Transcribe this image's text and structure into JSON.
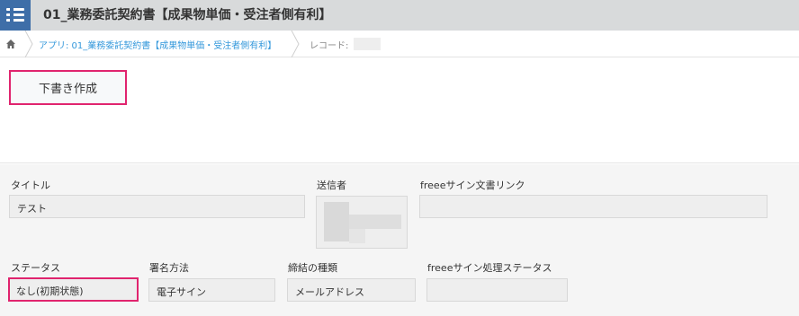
{
  "header": {
    "title": "01_業務委託契約書【成果物単価・受注者側有利】",
    "icon": "menu-list-icon"
  },
  "breadcrumb": {
    "home_icon": "home-icon",
    "app_link": "アプリ: 01_業務委託契約書【成果物単価・受注者側有利】",
    "record_label": "レコード:"
  },
  "toolbar": {
    "draft_button": "下書き作成"
  },
  "form": {
    "title_label": "タイトル",
    "title_value": "テスト",
    "sender_label": "送信者",
    "doc_link_label": "freeeサイン文書リンク",
    "doc_link_value": "",
    "status_label": "ステータス",
    "status_value": "なし(初期状態)",
    "sign_method_label": "署名方法",
    "sign_method_value": "電子サイン",
    "contract_type_label": "締結の種類",
    "contract_type_value": "メールアドレス",
    "processing_status_label": "freeeサイン処理ステータス",
    "processing_status_value": ""
  },
  "colors": {
    "header_bg": "#d8dadb",
    "app_icon_bg": "#3e6ea8",
    "link": "#3498db",
    "highlight": "#e0246e"
  }
}
